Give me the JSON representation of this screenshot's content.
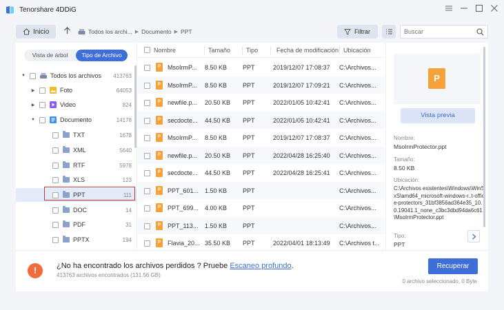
{
  "app": {
    "title": "Tenorshare 4DDiG",
    "accent_color": "#3e6fd8"
  },
  "window_controls": [
    "menu-icon",
    "minimize-icon",
    "maximize-icon",
    "close-icon"
  ],
  "nav": {
    "home_label": "Inicio",
    "breadcrumb": [
      "Todos los archi...",
      "Documento",
      "PPT"
    ],
    "filter_label": "Filtrar",
    "search_placeholder": "Buscar"
  },
  "left_panel": {
    "view_tabs": [
      {
        "label": "Vista de árbol",
        "active": false
      },
      {
        "label": "Tipo de Archivo",
        "active": true
      }
    ],
    "tree": [
      {
        "label": "Todos los archivos",
        "count": "413763",
        "level": 0,
        "expand": "down",
        "icon": "drive-icon"
      },
      {
        "label": "Foto",
        "count": "64053",
        "level": 1,
        "expand": "right",
        "icon": "photo-icon"
      },
      {
        "label": "Video",
        "count": "824",
        "level": 1,
        "expand": "right",
        "icon": "video-icon"
      },
      {
        "label": "Documento",
        "count": "14178",
        "level": 1,
        "expand": "down",
        "icon": "document-icon"
      },
      {
        "label": "TXT",
        "count": "1678",
        "level": 2,
        "icon": "folder-icon"
      },
      {
        "label": "XML",
        "count": "5640",
        "level": 2,
        "icon": "folder-icon"
      },
      {
        "label": "RTF",
        "count": "5978",
        "level": 2,
        "icon": "folder-icon"
      },
      {
        "label": "XLS",
        "count": "123",
        "level": 2,
        "icon": "folder-icon"
      },
      {
        "label": "PPT",
        "count": "111",
        "level": 2,
        "icon": "folder-icon",
        "selected": true
      },
      {
        "label": "DOC",
        "count": "14",
        "level": 2,
        "icon": "folder-icon"
      },
      {
        "label": "PDF",
        "count": "31",
        "level": 2,
        "icon": "folder-icon"
      },
      {
        "label": "PPTX",
        "count": "194",
        "level": 2,
        "icon": "folder-icon"
      }
    ]
  },
  "table": {
    "columns": [
      "Nombre",
      "Tamaño",
      "Tipo",
      "Fecha de modificación",
      "Ubicación"
    ],
    "rows": [
      {
        "name": "MsoIrmP...",
        "size": "8.50 KB",
        "type": "PPT",
        "date": "2019/12/07 17:08:37",
        "location": "C:\\Archivos..."
      },
      {
        "name": "MsoIrmP...",
        "size": "8.50 KB",
        "type": "PPT",
        "date": "2019/12/07 17:09:21",
        "location": "C:\\Archivos..."
      },
      {
        "name": "newfile.p...",
        "size": "20.50 KB",
        "type": "PPT",
        "date": "2022/01/05 10:42:41",
        "location": "C:\\Archivos..."
      },
      {
        "name": "secdocte...",
        "size": "44.50 KB",
        "type": "PPT",
        "date": "2022/01/05 10:42:41",
        "location": "C:\\Archivos..."
      },
      {
        "name": "MsoIrmP...",
        "size": "8.50 KB",
        "type": "PPT",
        "date": "2019/12/07 17:08:37",
        "location": "C:\\Archivos..."
      },
      {
        "name": "newfile.p...",
        "size": "20.50 KB",
        "type": "PPT",
        "date": "2022/04/28 16:25:40",
        "location": "C:\\Archivos..."
      },
      {
        "name": "secdocte...",
        "size": "44.50 KB",
        "type": "PPT",
        "date": "2022/04/28 16:25:41",
        "location": "C:\\Archivos..."
      },
      {
        "name": "PPT_601...",
        "size": "1.50 KB",
        "type": "PPT",
        "date": "",
        "location": "C:\\Archivos..."
      },
      {
        "name": "PPT_699...",
        "size": "4.00 KB",
        "type": "PPT",
        "date": "",
        "location": "C:\\Archivos..."
      },
      {
        "name": "PPT_113...",
        "size": "1.50 KB",
        "type": "PPT",
        "date": "",
        "location": "C:\\Archivos..."
      },
      {
        "name": "Flavia_20...",
        "size": "35.50 KB",
        "type": "PPT",
        "date": "2022/04/01 18:13:49",
        "location": "C:\\Archivos t..."
      }
    ]
  },
  "details": {
    "preview_glyph": "P",
    "preview_button": "Vista previa",
    "name_label": "Nombre:",
    "name_value": "MsoIrmProtector.ppt",
    "size_label": "Tamaño:",
    "size_value": "8.50 KB",
    "location_label": "Ubicación:",
    "location_value": "C:\\Archivos existentes\\Windows\\WinSxS\\amd64_microsoft-windows-r..t-office-protectors_31bf3856ad364e35_10.0.19041.1_none_c3bc3dbd94da6c61\\MsoIrmProtector.ppt",
    "type_label": "Tipo:",
    "type_value": "PPT"
  },
  "bottom": {
    "message_prefix": "¿No ha encontrado los archivos perdidos ? Pruebe ",
    "message_link": "Escaneo profundo",
    "message_suffix": ".",
    "found_count": "413763 archivos encontrados (131.56 GB)",
    "recover_label": "Recuperar",
    "selection_status": "0 archivo seleccionado, 0 Byte"
  }
}
